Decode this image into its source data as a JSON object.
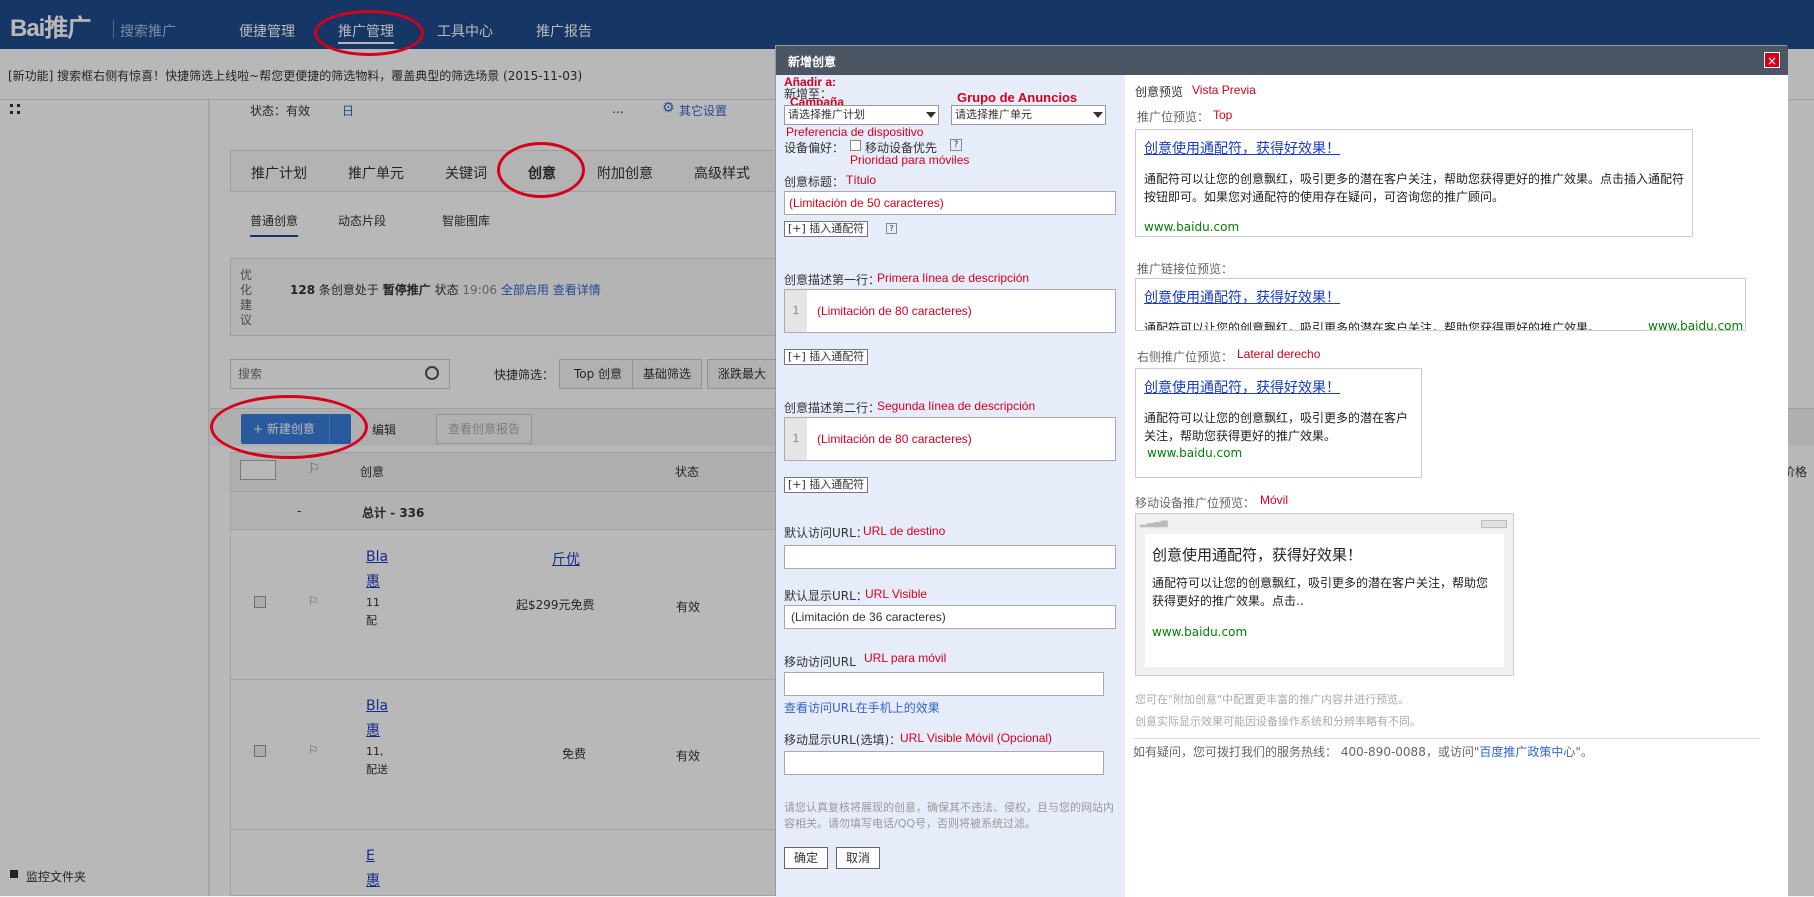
{
  "header": {
    "logo": "Bai推广",
    "logo_sub": "搜索推广",
    "nav": [
      "便捷管理",
      "推广管理",
      "工具中心",
      "推广报告"
    ]
  },
  "notice": "[新功能] 搜索框右侧有惊喜！快捷筛选上线啦~帮您更便捷的筛选物料，覆盖典型的筛选场景 (2015-11-03)",
  "sidebar": {
    "folder": "监控文件夹"
  },
  "status_bar": {
    "status": "状态：有效",
    "date": "日",
    "more": "...",
    "other_settings": "其它设置"
  },
  "tabs": [
    "推广计划",
    "推广单元",
    "关键词",
    "创意",
    "附加创意",
    "高级样式"
  ],
  "subtabs": [
    "普通创意",
    "动态片段",
    "智能图库"
  ],
  "optimize": {
    "label": "优化建议",
    "count": "128",
    "text1": "条创意处于",
    "state": "暂停推广",
    "text2": "状态",
    "time": "19:06",
    "enable_all": "全部启用",
    "details": "查看详情"
  },
  "search": {
    "placeholder": "搜索"
  },
  "quick_filter": {
    "label": "快捷筛选：",
    "btns": [
      "Top 创意",
      "基础筛选",
      "涨跌最大"
    ]
  },
  "toolbar": {
    "new": "+ 新建创意",
    "edit": "编辑",
    "report": "查看创意报告"
  },
  "table": {
    "headers": [
      "创意",
      "状态"
    ],
    "total_label": "总计 - 336",
    "total_dash": "-",
    "rows": [
      {
        "title1": "Bla",
        "title2": "惠",
        "desc1": "11",
        "desc2": "配",
        "link": "斤优",
        "price": "起$299元免费",
        "status": "有效"
      },
      {
        "title1": "Bla",
        "title2": "惠",
        "desc1": "11,",
        "desc2": "配送",
        "link": "",
        "price": "免费",
        "status": "有效"
      },
      {
        "title1": "E",
        "title2": "惠",
        "desc1": "",
        "desc2": "",
        "link": "",
        "price": "",
        "status": ""
      }
    ],
    "right_col": "价格"
  },
  "dialog": {
    "title": "新增创意",
    "close": "×",
    "add_to": "新增至：",
    "add_to_es": "Añadir a:",
    "campaign_es": "Campaña",
    "group_es": "Grupo de Anuncios",
    "campaign_select": "请选择推广计划",
    "unit_select": "请选择推广单元",
    "device_es": "Preferencia de dispositivo",
    "device_label": "设备偏好：",
    "mobile_priority": "移动设备优先",
    "mobile_priority_es": "Prioridad para móviles",
    "title_label": "创意标题：",
    "title_es": "Título",
    "title_val": "(Limitación de 50 caracteres)",
    "insert": "插入通配符",
    "desc1_label": "创意描述第一行：",
    "desc1_es": "Primera línea de descripción",
    "desc1_val": "(Limitación de 80 caracteres)",
    "desc2_label": "创意描述第二行：",
    "desc2_es": "Segunda línea de descripción",
    "desc2_val": "(Limitación de 80 caracteres)",
    "url_label": "默认访问URL：",
    "url_es": "URL de destino",
    "display_label": "默认显示URL：",
    "display_es": "URL Visible",
    "display_val": "(Limitación de 36 caracteres)",
    "murl_label": "移动访问URL",
    "murl_es": "URL para móvil",
    "murl_link": "查看访问URL在手机上的效果",
    "mdisplay_label": "移动显示URL(选填)：",
    "mdisplay_es": "URL Visible Móvil (Opcional)",
    "disclaimer": "请您认真复核将展现的创意，确保其不违法、侵权，且与您的网站内容相关。请勿填写电话/QQ号，否则将被系统过滤。",
    "ok": "确定",
    "cancel": "取消",
    "preview": {
      "heading": "创意预览",
      "heading_es": "Vista Previa",
      "top_label": "推广位预览：",
      "top_es": "Top",
      "link_label": "推广链接位预览：",
      "right_label": "右侧推广位预览：",
      "right_es": "Lateral derecho",
      "mobile_label": "移动设备推广位预览：",
      "mobile_es": "Móvil",
      "ad_title": "创意使用通配符，获得好效果！",
      "ad_desc": "通配符可以让您的创意飘红，吸引更多的潜在客户关注，帮助您获得更好的推广效果。点击插入通配符按钮即可。如果您对通配符的使用存在疑问，可咨询您的推广顾问。",
      "ad_desc_short": "通配符可以让您的创意飘红，吸引更多的潜在客户关注，帮助您获得更好的推广效果。",
      "ad_desc_link": "通配符可以让您的创意飘红，吸引更多的潜在客户关注，帮助您获得更好的推广效果。",
      "ad_desc_mobile": "通配符可以让您的创意飘红，吸引更多的潜在客户关注，帮助您获得更好的推广效果。点击..",
      "ad_url": "www.baidu.com",
      "note1": "您可在\"附加创意\"中配置更丰富的推广内容并进行预览。",
      "note2": "创意实际显示效果可能因设备操作系统和分辨率略有不同。",
      "footer": "如有疑问，您可拨打我们的服务热线：  400-890-0088，或访问\"",
      "footer_link": "百度推广政策中心",
      "footer_end": "\"。"
    }
  },
  "colors": {
    "brand": "#1f4d8e",
    "accent": "#3a7ddc",
    "annotation": "#d6001c"
  }
}
